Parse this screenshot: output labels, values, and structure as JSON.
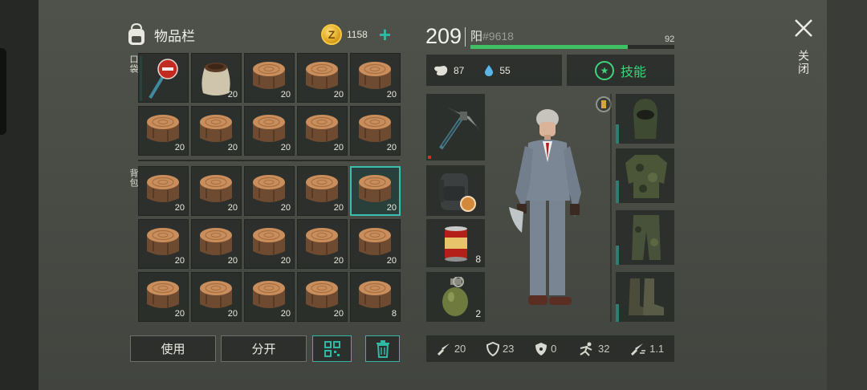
{
  "inventory": {
    "title": "物品栏",
    "coins": "1158",
    "pocket_label": "口袋",
    "backpack_label": "背包",
    "pocket_slots": [
      {
        "item": "stop-sign-club",
        "count": ""
      },
      {
        "item": "seed-sack",
        "count": "20"
      },
      {
        "item": "wood-log",
        "count": "20"
      },
      {
        "item": "wood-log",
        "count": "20"
      },
      {
        "item": "wood-log",
        "count": "20"
      },
      {
        "item": "wood-log",
        "count": "20"
      },
      {
        "item": "wood-log",
        "count": "20"
      },
      {
        "item": "wood-log",
        "count": "20"
      },
      {
        "item": "wood-log",
        "count": "20"
      },
      {
        "item": "wood-log",
        "count": "20"
      }
    ],
    "backpack_slots": [
      {
        "item": "wood-log",
        "count": "20"
      },
      {
        "item": "wood-log",
        "count": "20"
      },
      {
        "item": "wood-log",
        "count": "20"
      },
      {
        "item": "wood-log",
        "count": "20"
      },
      {
        "item": "wood-log",
        "count": "20",
        "selected": true
      },
      {
        "item": "wood-log",
        "count": "20"
      },
      {
        "item": "wood-log",
        "count": "20"
      },
      {
        "item": "wood-log",
        "count": "20"
      },
      {
        "item": "wood-log",
        "count": "20"
      },
      {
        "item": "wood-log",
        "count": "20"
      },
      {
        "item": "wood-log",
        "count": "20"
      },
      {
        "item": "wood-log",
        "count": "20"
      },
      {
        "item": "wood-log",
        "count": "20"
      },
      {
        "item": "wood-log",
        "count": "20"
      },
      {
        "item": "wood-log",
        "count": "8"
      }
    ],
    "use_label": "使用",
    "split_label": "分开"
  },
  "player": {
    "health": "209",
    "name": "阳",
    "id": "#9618",
    "level": "92",
    "xp_fraction": 0.77,
    "hunger": "87",
    "thirst": "55",
    "skill_label": "技能"
  },
  "equipment": {
    "weapon": {
      "item": "pickaxe",
      "count": ""
    },
    "backpack": {
      "item": "military-backpack",
      "count": ""
    },
    "food": {
      "item": "canned-food",
      "count": "8"
    },
    "grenade": {
      "item": "frag-grenade",
      "count": "2"
    },
    "head": {
      "item": "balaclava"
    },
    "body": {
      "item": "camo-jacket"
    },
    "legs": {
      "item": "camo-pants"
    },
    "feet": {
      "item": "combat-boots"
    }
  },
  "stats": {
    "attack": "20",
    "defense": "23",
    "radiation": "0",
    "speed": "32",
    "attack_speed": "1.1"
  },
  "close_label": "关闭",
  "colors": {
    "accent": "#2fb9a4",
    "xp": "#3ec063",
    "skill": "#3fd37c"
  }
}
